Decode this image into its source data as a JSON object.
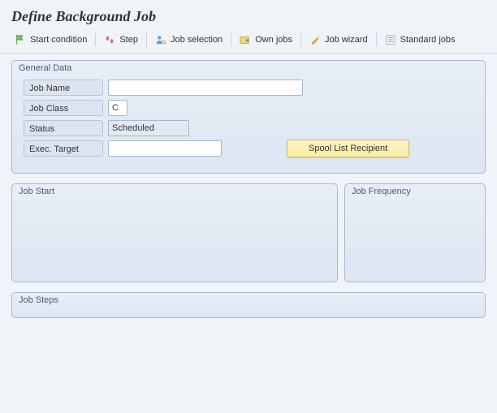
{
  "title": "Define Background Job",
  "toolbar": {
    "start_condition": "Start condition",
    "step": "Step",
    "job_selection": "Job selection",
    "own_jobs": "Own jobs",
    "job_wizard": "Job wizard",
    "standard_jobs": "Standard jobs"
  },
  "groups": {
    "general_data": "General Data",
    "job_start": "Job Start",
    "job_frequency": "Job Frequency",
    "job_steps": "Job Steps"
  },
  "fields": {
    "job_name": {
      "label": "Job Name",
      "value": ""
    },
    "job_class": {
      "label": "Job Class",
      "value": "C"
    },
    "status": {
      "label": "Status",
      "value": "Scheduled"
    },
    "exec_target": {
      "label": "Exec. Target",
      "value": ""
    }
  },
  "buttons": {
    "spool_recipient": "Spool List Recipient"
  }
}
